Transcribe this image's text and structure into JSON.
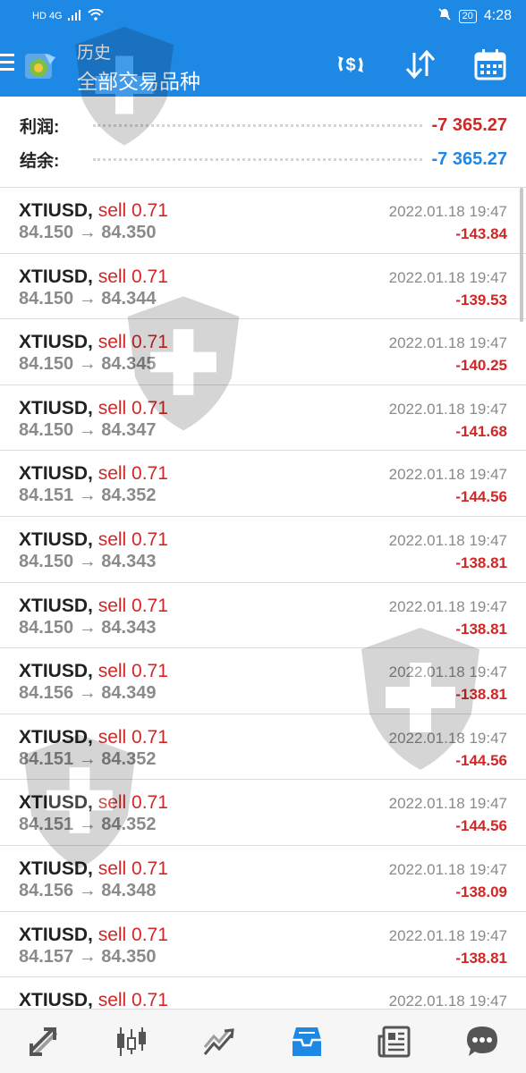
{
  "status_bar": {
    "network": "HD 4G",
    "battery": "20",
    "time": "4:28"
  },
  "header": {
    "title": "历史",
    "subtitle": "全部交易品种"
  },
  "summary": {
    "profit_label": "利润:",
    "profit_value": "-7 365.27",
    "balance_label": "结余:",
    "balance_value": "-7 365.27"
  },
  "deals": [
    {
      "symbol": "XTIUSD,",
      "type": "sell 0.71",
      "prices": "84.150 → 84.350",
      "time": "2022.01.18 19:47",
      "profit": "-143.84"
    },
    {
      "symbol": "XTIUSD,",
      "type": "sell 0.71",
      "prices": "84.150 → 84.344",
      "time": "2022.01.18 19:47",
      "profit": "-139.53"
    },
    {
      "symbol": "XTIUSD,",
      "type": "sell 0.71",
      "prices": "84.150 → 84.345",
      "time": "2022.01.18 19:47",
      "profit": "-140.25"
    },
    {
      "symbol": "XTIUSD,",
      "type": "sell 0.71",
      "prices": "84.150 → 84.347",
      "time": "2022.01.18 19:47",
      "profit": "-141.68"
    },
    {
      "symbol": "XTIUSD,",
      "type": "sell 0.71",
      "prices": "84.151 → 84.352",
      "time": "2022.01.18 19:47",
      "profit": "-144.56"
    },
    {
      "symbol": "XTIUSD,",
      "type": "sell 0.71",
      "prices": "84.150 → 84.343",
      "time": "2022.01.18 19:47",
      "profit": "-138.81"
    },
    {
      "symbol": "XTIUSD,",
      "type": "sell 0.71",
      "prices": "84.150 → 84.343",
      "time": "2022.01.18 19:47",
      "profit": "-138.81"
    },
    {
      "symbol": "XTIUSD,",
      "type": "sell 0.71",
      "prices": "84.156 → 84.349",
      "time": "2022.01.18 19:47",
      "profit": "-138.81"
    },
    {
      "symbol": "XTIUSD,",
      "type": "sell 0.71",
      "prices": "84.151 → 84.352",
      "time": "2022.01.18 19:47",
      "profit": "-144.56"
    },
    {
      "symbol": "XTIUSD,",
      "type": "sell 0.71",
      "prices": "84.151 → 84.352",
      "time": "2022.01.18 19:47",
      "profit": "-144.56"
    },
    {
      "symbol": "XTIUSD,",
      "type": "sell 0.71",
      "prices": "84.156 → 84.348",
      "time": "2022.01.18 19:47",
      "profit": "-138.09"
    },
    {
      "symbol": "XTIUSD,",
      "type": "sell 0.71",
      "prices": "84.157 → 84.350",
      "time": "2022.01.18 19:47",
      "profit": "-138.81"
    },
    {
      "symbol": "XTIUSD,",
      "type": "sell 0.71",
      "prices": "",
      "time": "2022.01.18 19:47",
      "profit": ""
    }
  ],
  "nav": [
    {
      "icon": "quotes-icon"
    },
    {
      "icon": "chart-icon"
    },
    {
      "icon": "trade-icon"
    },
    {
      "icon": "history-icon",
      "active": true
    },
    {
      "icon": "news-icon"
    },
    {
      "icon": "chat-icon"
    }
  ],
  "colors": {
    "accent": "#1e88e5",
    "loss": "#d02727",
    "muted": "#8a8a8a"
  }
}
